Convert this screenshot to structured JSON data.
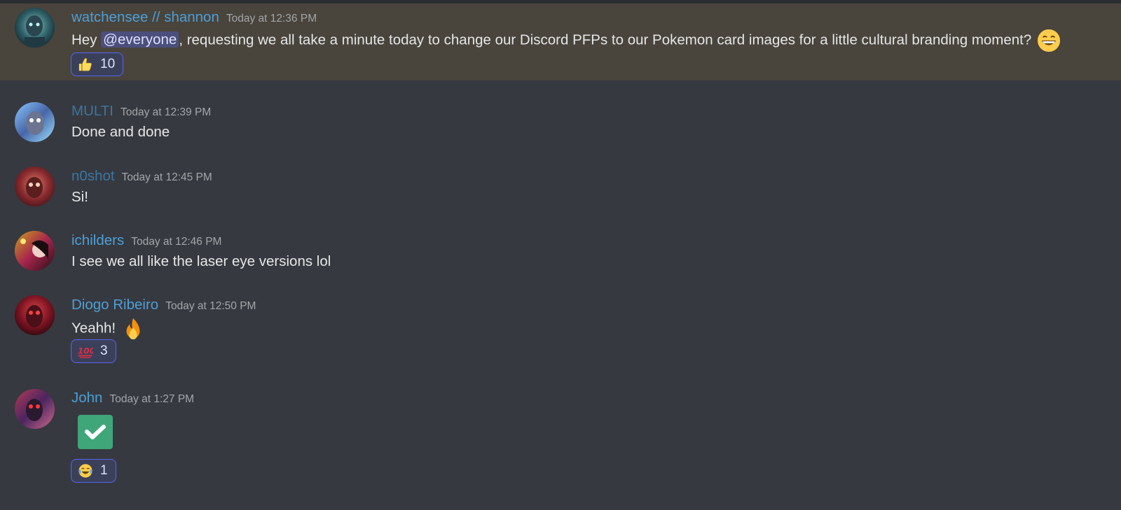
{
  "messages": [
    {
      "author": "watchensee // shannon",
      "timestamp": "Today at 12:36 PM",
      "text_before": "Hey ",
      "mention": "@everyone",
      "text_after": ", requesting we all take a minute today to change our Discord PFPs to our Pokemon card images for a little cultural branding moment?",
      "inline_emoji": "grinning-face-icon",
      "reaction": {
        "emoji": "thumbs-up-icon",
        "count": "10"
      }
    },
    {
      "author": "MULTI",
      "timestamp": "Today at 12:39 PM",
      "text": "Done and done"
    },
    {
      "author": "n0shot",
      "timestamp": "Today at 12:45 PM",
      "text": "Si!"
    },
    {
      "author": "ichilders",
      "timestamp": "Today at 12:46 PM",
      "text": "I see we all like the laser eye versions lol"
    },
    {
      "author": "Diogo Ribeiro",
      "timestamp": "Today at 12:50 PM",
      "text": "Yeahh!",
      "inline_emoji": "fire-icon",
      "reaction": {
        "emoji": "hundred-points-icon",
        "count": "3"
      }
    },
    {
      "author": "John",
      "timestamp": "Today at 1:27 PM",
      "attachment_emoji": "check-mark-button-icon",
      "reaction": {
        "emoji": "tears-of-joy-icon",
        "count": "1"
      }
    }
  ],
  "colors": {
    "background": "#36393f",
    "highlight": "#49443c",
    "author": "#4d9fd6",
    "timestamp": "#a3a6aa",
    "mention_bg": "#4b4f7c",
    "reaction_border": "#5865f2"
  }
}
